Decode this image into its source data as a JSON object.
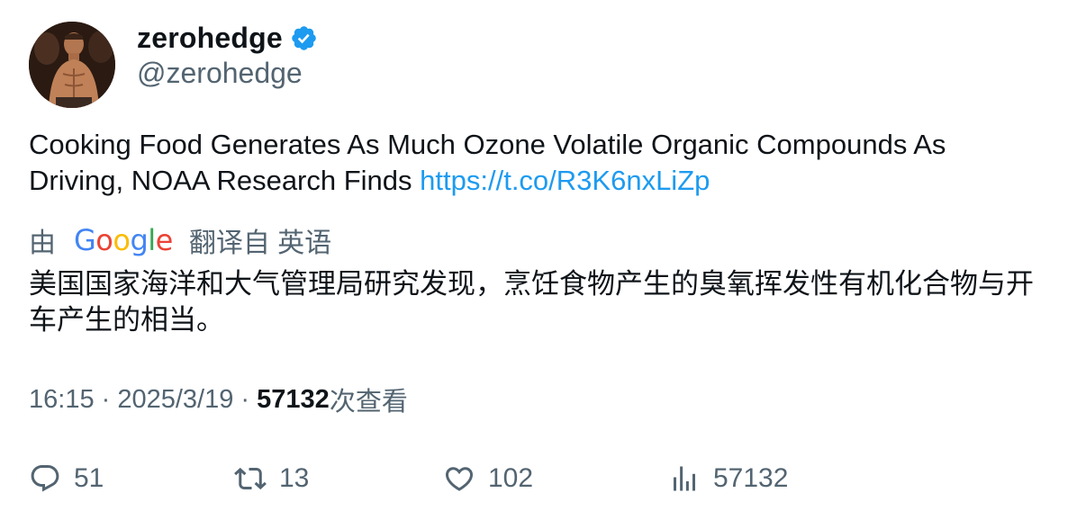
{
  "author": {
    "display_name": "zerohedge",
    "handle": "@zerohedge",
    "verified": true,
    "verified_color": "#1d9bf0"
  },
  "tweet": {
    "text": "Cooking Food Generates As Much Ozone Volatile Organic Compounds As Driving, NOAA Research Finds ",
    "link": "https://t.co/R3K6nxLiZp",
    "link_color": "#1d9bf0"
  },
  "translation": {
    "prefix": "由",
    "provider_letters": [
      "G",
      "o",
      "o",
      "g",
      "l",
      "e"
    ],
    "suffix": "翻译自 英语",
    "text": "美国国家海洋和大气管理局研究发现，烹饪食物产生的臭氧挥发性有机化合物与开车产生的相当。"
  },
  "meta": {
    "time": "16:15",
    "separator": " · ",
    "date": "2025/3/19",
    "views_count": "57132",
    "views_label": "次查看"
  },
  "actions": {
    "reply_count": "51",
    "retweet_count": "13",
    "like_count": "102",
    "views_count": "57132"
  },
  "icons": {
    "reply": "reply-icon",
    "retweet": "retweet-icon",
    "like": "heart-icon",
    "views": "analytics-icon",
    "verified": "verified-badge-icon"
  }
}
